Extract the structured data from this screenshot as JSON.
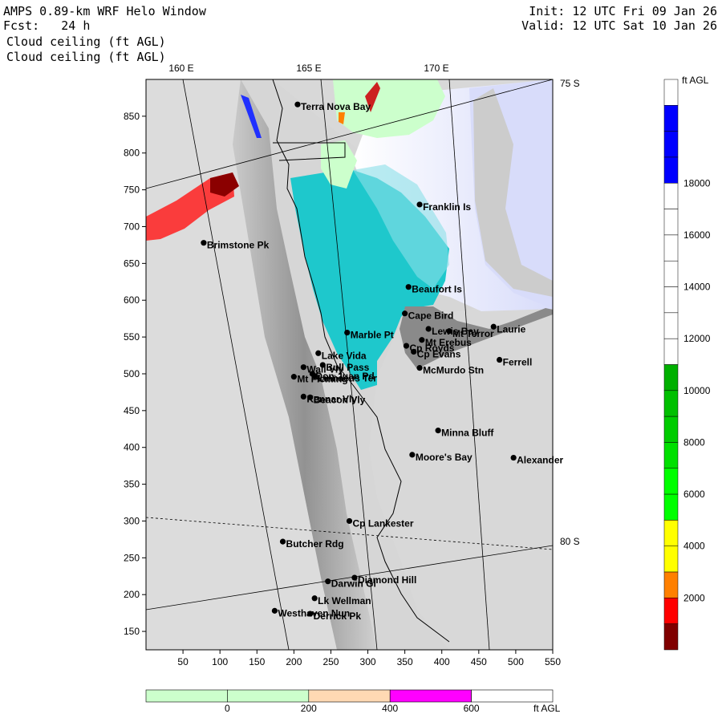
{
  "header": {
    "model_line": "AMPS 0.89-km WRF Helo Window",
    "forecast_label": "Fcst:",
    "forecast_hours": "24 h",
    "field_line_1": "Cloud ceiling (ft AGL)",
    "field_line_2": "Cloud ceiling (ft AGL)",
    "init_label": "Init:",
    "init_value": "12 UTC Fri 09 Jan 26",
    "valid_label": "Valid:",
    "valid_value": "12 UTC Sat 10 Jan 26"
  },
  "map": {
    "x_axis_ticks": [
      50,
      100,
      150,
      200,
      250,
      300,
      350,
      400,
      450,
      500,
      550
    ],
    "y_axis_ticks": [
      150,
      200,
      250,
      300,
      350,
      400,
      450,
      500,
      550,
      600,
      650,
      700,
      750,
      800,
      850
    ],
    "x_range": [
      0,
      550
    ],
    "y_range": [
      125,
      900
    ],
    "longitude_labels": [
      "160 E",
      "165 E",
      "170 E"
    ],
    "latitude_labels": [
      "75 S",
      "80 S"
    ],
    "places": [
      {
        "name": "Terra Nova Bay",
        "x": 205,
        "y": 866
      },
      {
        "name": "Brimstone Pk",
        "x": 78,
        "y": 678
      },
      {
        "name": "Franklin Is",
        "x": 370,
        "y": 730
      },
      {
        "name": "Beaufort Is",
        "x": 355,
        "y": 618
      },
      {
        "name": "Cape Bird",
        "x": 350,
        "y": 582
      },
      {
        "name": "Lewis Bay",
        "x": 382,
        "y": 561
      },
      {
        "name": "Laurie",
        "x": 470,
        "y": 564
      },
      {
        "name": "Mt Terror",
        "x": 410,
        "y": 558
      },
      {
        "name": "Marble Pt",
        "x": 272,
        "y": 556
      },
      {
        "name": "Cp Royds",
        "x": 352,
        "y": 538
      },
      {
        "name": "Mt Erebus",
        "x": 373,
        "y": 546
      },
      {
        "name": "Lake Vida",
        "x": 233,
        "y": 528
      },
      {
        "name": "Cp Evans",
        "x": 362,
        "y": 530
      },
      {
        "name": "Ferrell",
        "x": 478,
        "y": 519
      },
      {
        "name": "Wall Vly",
        "x": 213,
        "y": 509
      },
      {
        "name": "Bull Pass",
        "x": 239,
        "y": 512
      },
      {
        "name": "McMurdo Stn",
        "x": 370,
        "y": 508
      },
      {
        "name": "Don Juan Pd",
        "x": 225,
        "y": 500
      },
      {
        "name": "Mt Fleming",
        "x": 200,
        "y": 496
      },
      {
        "name": "Linnaeus Ter",
        "x": 228,
        "y": 497
      },
      {
        "name": "Kennar Vly",
        "x": 213,
        "y": 469
      },
      {
        "name": "Beacon Vly",
        "x": 222,
        "y": 468
      },
      {
        "name": "Minna Bluff",
        "x": 395,
        "y": 423
      },
      {
        "name": "Moore's Bay",
        "x": 360,
        "y": 390
      },
      {
        "name": "Alexander",
        "x": 497,
        "y": 386
      },
      {
        "name": "Cp Lankester",
        "x": 275,
        "y": 300
      },
      {
        "name": "Butcher Rdg",
        "x": 185,
        "y": 272
      },
      {
        "name": "Diamond Hill",
        "x": 282,
        "y": 223
      },
      {
        "name": "Darwin Gl",
        "x": 246,
        "y": 218
      },
      {
        "name": "Lk Wellman",
        "x": 228,
        "y": 195
      },
      {
        "name": "Westhaven Nun",
        "x": 174,
        "y": 178
      },
      {
        "name": "Derrick Pk",
        "x": 222,
        "y": 174
      }
    ]
  },
  "colorbar_right": {
    "unit": "ft AGL",
    "ticks": [
      "2000",
      "4000",
      "6000",
      "8000",
      "10000",
      "12000",
      "14000",
      "16000",
      "18000"
    ],
    "colors": [
      "#800000",
      "#ff0000",
      "#ff8000",
      "#ffff00",
      "#ffff00",
      "#00ff00",
      "#00ff00",
      "#00e000",
      "#00cc00",
      "#00c000",
      "#00b000",
      "#ffffff",
      "#ffffff",
      "#ffffff",
      "#ffffff",
      "#ffffff",
      "#ffffff",
      "#ffffff",
      "#0000ff",
      "#0000ff",
      "#0000ff",
      "#ffffff"
    ]
  },
  "colorbar_bottom": {
    "unit": "ft AGL",
    "ticks": [
      "0",
      "200",
      "400",
      "600"
    ],
    "colors": [
      "#ccffcc",
      "#ccffcc",
      "#ffd9b3",
      "#ff00ff",
      "#ffffff"
    ]
  }
}
